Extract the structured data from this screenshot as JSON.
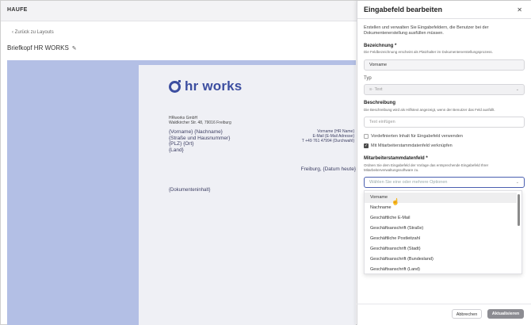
{
  "app": {
    "brand": "HAUFE",
    "back_link": "‹ Zurück zu Layouts",
    "page_title": "Briefkopf HR WORKS"
  },
  "document": {
    "logo_text": "hr works",
    "company_line1": "HRworks GmbH",
    "company_line2": "Waldkircher Str. 48, 79016 Freiburg",
    "placeholders_left": [
      "{Vorname} {Nachname}",
      "{Straße und Hausnummer}",
      "{PLZ} {Ort}",
      "{Land}"
    ],
    "placeholders_right": [
      "Vorname {HR Name}",
      "E-Mail {E-Mail Adresse}",
      "T +49 761 47994 {Durchwahl}"
    ],
    "city_line": "Freiburg, {Datum heute}",
    "content_placeholder": "{Dokumenteninhalt}"
  },
  "dialog": {
    "title": "Eingabefeld bearbeiten",
    "close_icon": "close-icon",
    "intro": "Erstellen und verwalten Sie Eingabefeldern, die Benutzer bei der Dokumentenerstellung ausfüllen müssen.",
    "bezeichnung": {
      "label": "Bezeichnung *",
      "hint": "Die Feldbezeichnung erscheint als Platzhalter im Dokumentenerstellungsprozess.",
      "value": "Vorname"
    },
    "typ": {
      "label": "Typ",
      "value": "Text",
      "icon": "text-icon"
    },
    "beschreibung": {
      "label": "Beschreibung",
      "hint": "Die Beschreibung wird als Hilfstext angezeigt, wenn der Benutzer das Feld ausfüllt.",
      "placeholder": "Text einfügen"
    },
    "checkboxes": [
      {
        "label": "Vordefinierten Inhalt für Eingabefeld verwenden",
        "checked": false
      },
      {
        "label": "Mit Mitarbeiterstammdatenfeld verknüpfen",
        "checked": true
      }
    ],
    "stammdaten": {
      "label": "Mitarbeiterstammdatenfeld *",
      "hint": "Ordnen Sie dem Eingabefeld der Vorlage das entsprechende Eingabefeld Ihrer Mitarbeiterverwaltungssoftware zu.",
      "placeholder": "Wählen Sie eine oder mehrere Optionen"
    },
    "options": [
      "Vorname",
      "Nachname",
      "Geschäftliche E-Mail",
      "Geschäftsanschrift (Straße)",
      "Geschäftliche Postleitzahl",
      "Geschäftsanschrift (Stadt)",
      "Geschäftsanschrift (Bundesland)",
      "Geschäftsanschrift (Land)"
    ],
    "cancel_label": "Abbrechen",
    "update_label": "Aktualisieren"
  }
}
